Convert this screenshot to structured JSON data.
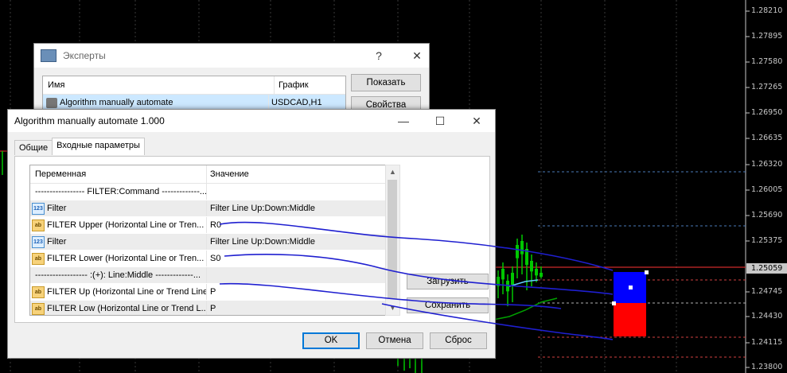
{
  "chart": {
    "price_labels": [
      "1.28210",
      "1.27895",
      "1.27580",
      "1.27265",
      "1.26950",
      "1.26635",
      "1.26320",
      "1.26005",
      "1.25690",
      "1.25375",
      "1.24745",
      "1.24430",
      "1.24115",
      "1.23800"
    ],
    "current_price": "1.25059",
    "colors": {
      "background": "#000000",
      "up_zone": "#0000ff",
      "down_zone": "#ff0000",
      "candle": "#00c800",
      "line_red": "#ff3333",
      "annotation": "#1f1fd0"
    }
  },
  "experts": {
    "title": "Эксперты",
    "help_icon": "?",
    "close_icon": "✕",
    "columns": [
      "Имя",
      "График"
    ],
    "rows": [
      {
        "name": "Algorithm manually automate",
        "chart": "USDCAD,H1"
      }
    ],
    "show_button": "Показать",
    "props_button": "Свойства"
  },
  "algo": {
    "title": "Algorithm manually automate 1.000",
    "minimize": "—",
    "maximize": "☐",
    "close": "✕",
    "tabs": [
      "Общие",
      "Входные параметры"
    ],
    "grid": {
      "columns": [
        "Переменная",
        "Значение"
      ],
      "rows": [
        {
          "icon": "",
          "name": "----------------- FILTER:Command -------------...",
          "value": ""
        },
        {
          "icon": "num",
          "name": "Filter",
          "value": "Filter Line Up:Down:Middle"
        },
        {
          "icon": "ab",
          "name": "FILTER Upper (Horizontal Line or Tren...",
          "value": "R0"
        },
        {
          "icon": "num",
          "name": "Filter",
          "value": "Filter Line Up:Down:Middle"
        },
        {
          "icon": "ab",
          "name": "FILTER Lower (Horizontal Line or Tren...",
          "value": "S0"
        },
        {
          "icon": "",
          "name": "------------------ :(+): Line:Middle -------------...",
          "value": ""
        },
        {
          "icon": "ab",
          "name": "FILTER Up (Horizontal Line or Trend Line)",
          "value": "P"
        },
        {
          "icon": "ab",
          "name": "FILTER Low (Horizontal Line or Trend L...",
          "value": "P"
        }
      ]
    },
    "load_button": "Загрузить",
    "save_button": "Сохранить",
    "ok_button": "OK",
    "cancel_button": "Отмена",
    "reset_button": "Сброс"
  }
}
